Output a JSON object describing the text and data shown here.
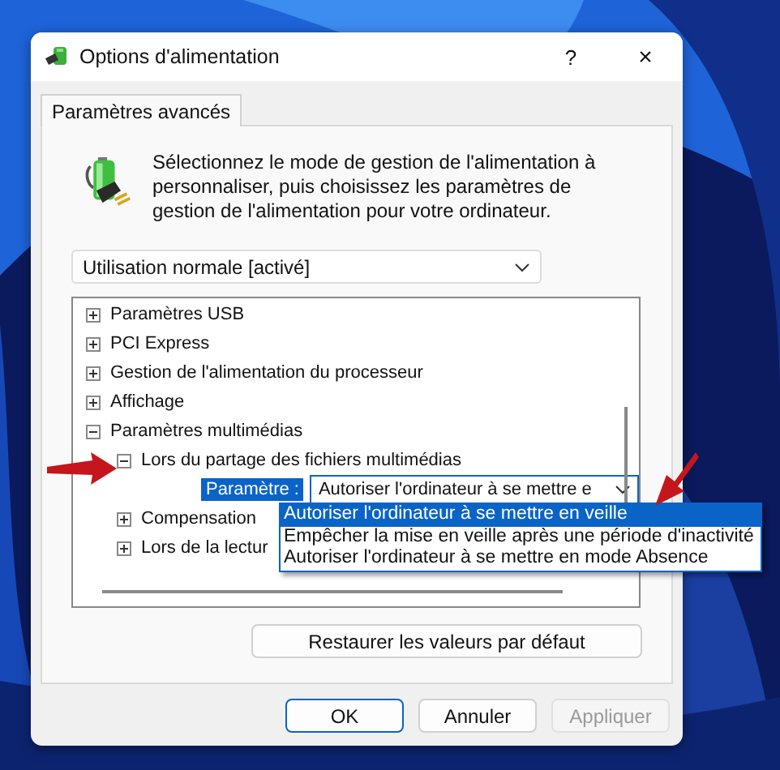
{
  "window": {
    "title": "Options d'alimentation",
    "help": "?",
    "close": "×"
  },
  "tabs": [
    {
      "label": "Paramètres avancés",
      "selected": true
    }
  ],
  "description": "Sélectionnez le mode de gestion de l'alimentation à personnaliser, puis choisissez les paramètres de gestion de l'alimentation pour votre ordinateur.",
  "plan_dropdown": {
    "value": "Utilisation normale [activé]"
  },
  "tree": [
    {
      "kind": "group",
      "label": "Paramètres USB",
      "expanded": false
    },
    {
      "kind": "group",
      "label": "PCI Express",
      "expanded": false
    },
    {
      "kind": "group",
      "label": "Gestion de l'alimentation du processeur",
      "expanded": false
    },
    {
      "kind": "group",
      "label": "Affichage",
      "expanded": false
    },
    {
      "kind": "group",
      "label": "Paramètres multimédias",
      "expanded": true,
      "children": [
        {
          "kind": "group",
          "label": "Lors du partage des fichiers multimédias",
          "expanded": true,
          "children": [
            {
              "kind": "setting",
              "label": "Paramètre :",
              "value": "Autoriser l'ordinateur à se mettre e",
              "selected": true
            }
          ]
        },
        {
          "kind": "group",
          "label": "Compensation",
          "expanded": false
        },
        {
          "kind": "group",
          "label": "Lors de la lectur",
          "expanded": false
        }
      ]
    }
  ],
  "dropdown_options": [
    {
      "label": "Autoriser l'ordinateur à se mettre en veille",
      "selected": true
    },
    {
      "label": "Empêcher la mise en veille après une période d'inactivité",
      "selected": false
    },
    {
      "label": "Autoriser l'ordinateur à se mettre en mode Absence",
      "selected": false
    }
  ],
  "restore_button": "Restaurer les valeurs par défaut",
  "buttons": [
    {
      "label": "OK",
      "kind": "default"
    },
    {
      "label": "Annuler",
      "kind": "normal"
    },
    {
      "label": "Appliquer",
      "kind": "disabled"
    }
  ]
}
